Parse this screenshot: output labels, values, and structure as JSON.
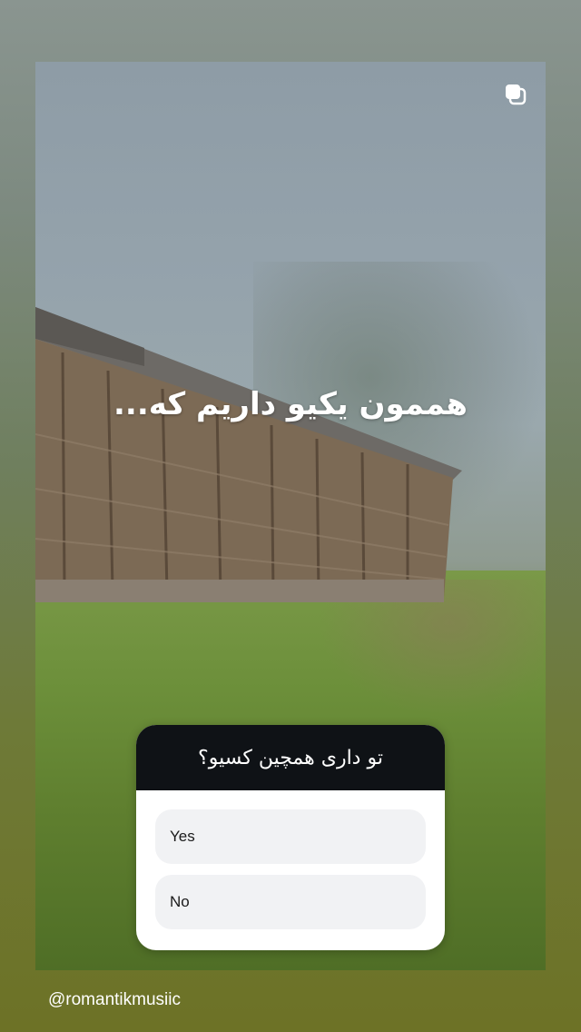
{
  "story": {
    "headline": "هممون یکیو داریم که...",
    "multi_media_icon": "stacked-squares-icon"
  },
  "poll": {
    "question": "تو داری همچین کسیو؟",
    "options": [
      {
        "label": "Yes"
      },
      {
        "label": "No"
      }
    ]
  },
  "footer": {
    "username": "@romantikmusiic"
  }
}
